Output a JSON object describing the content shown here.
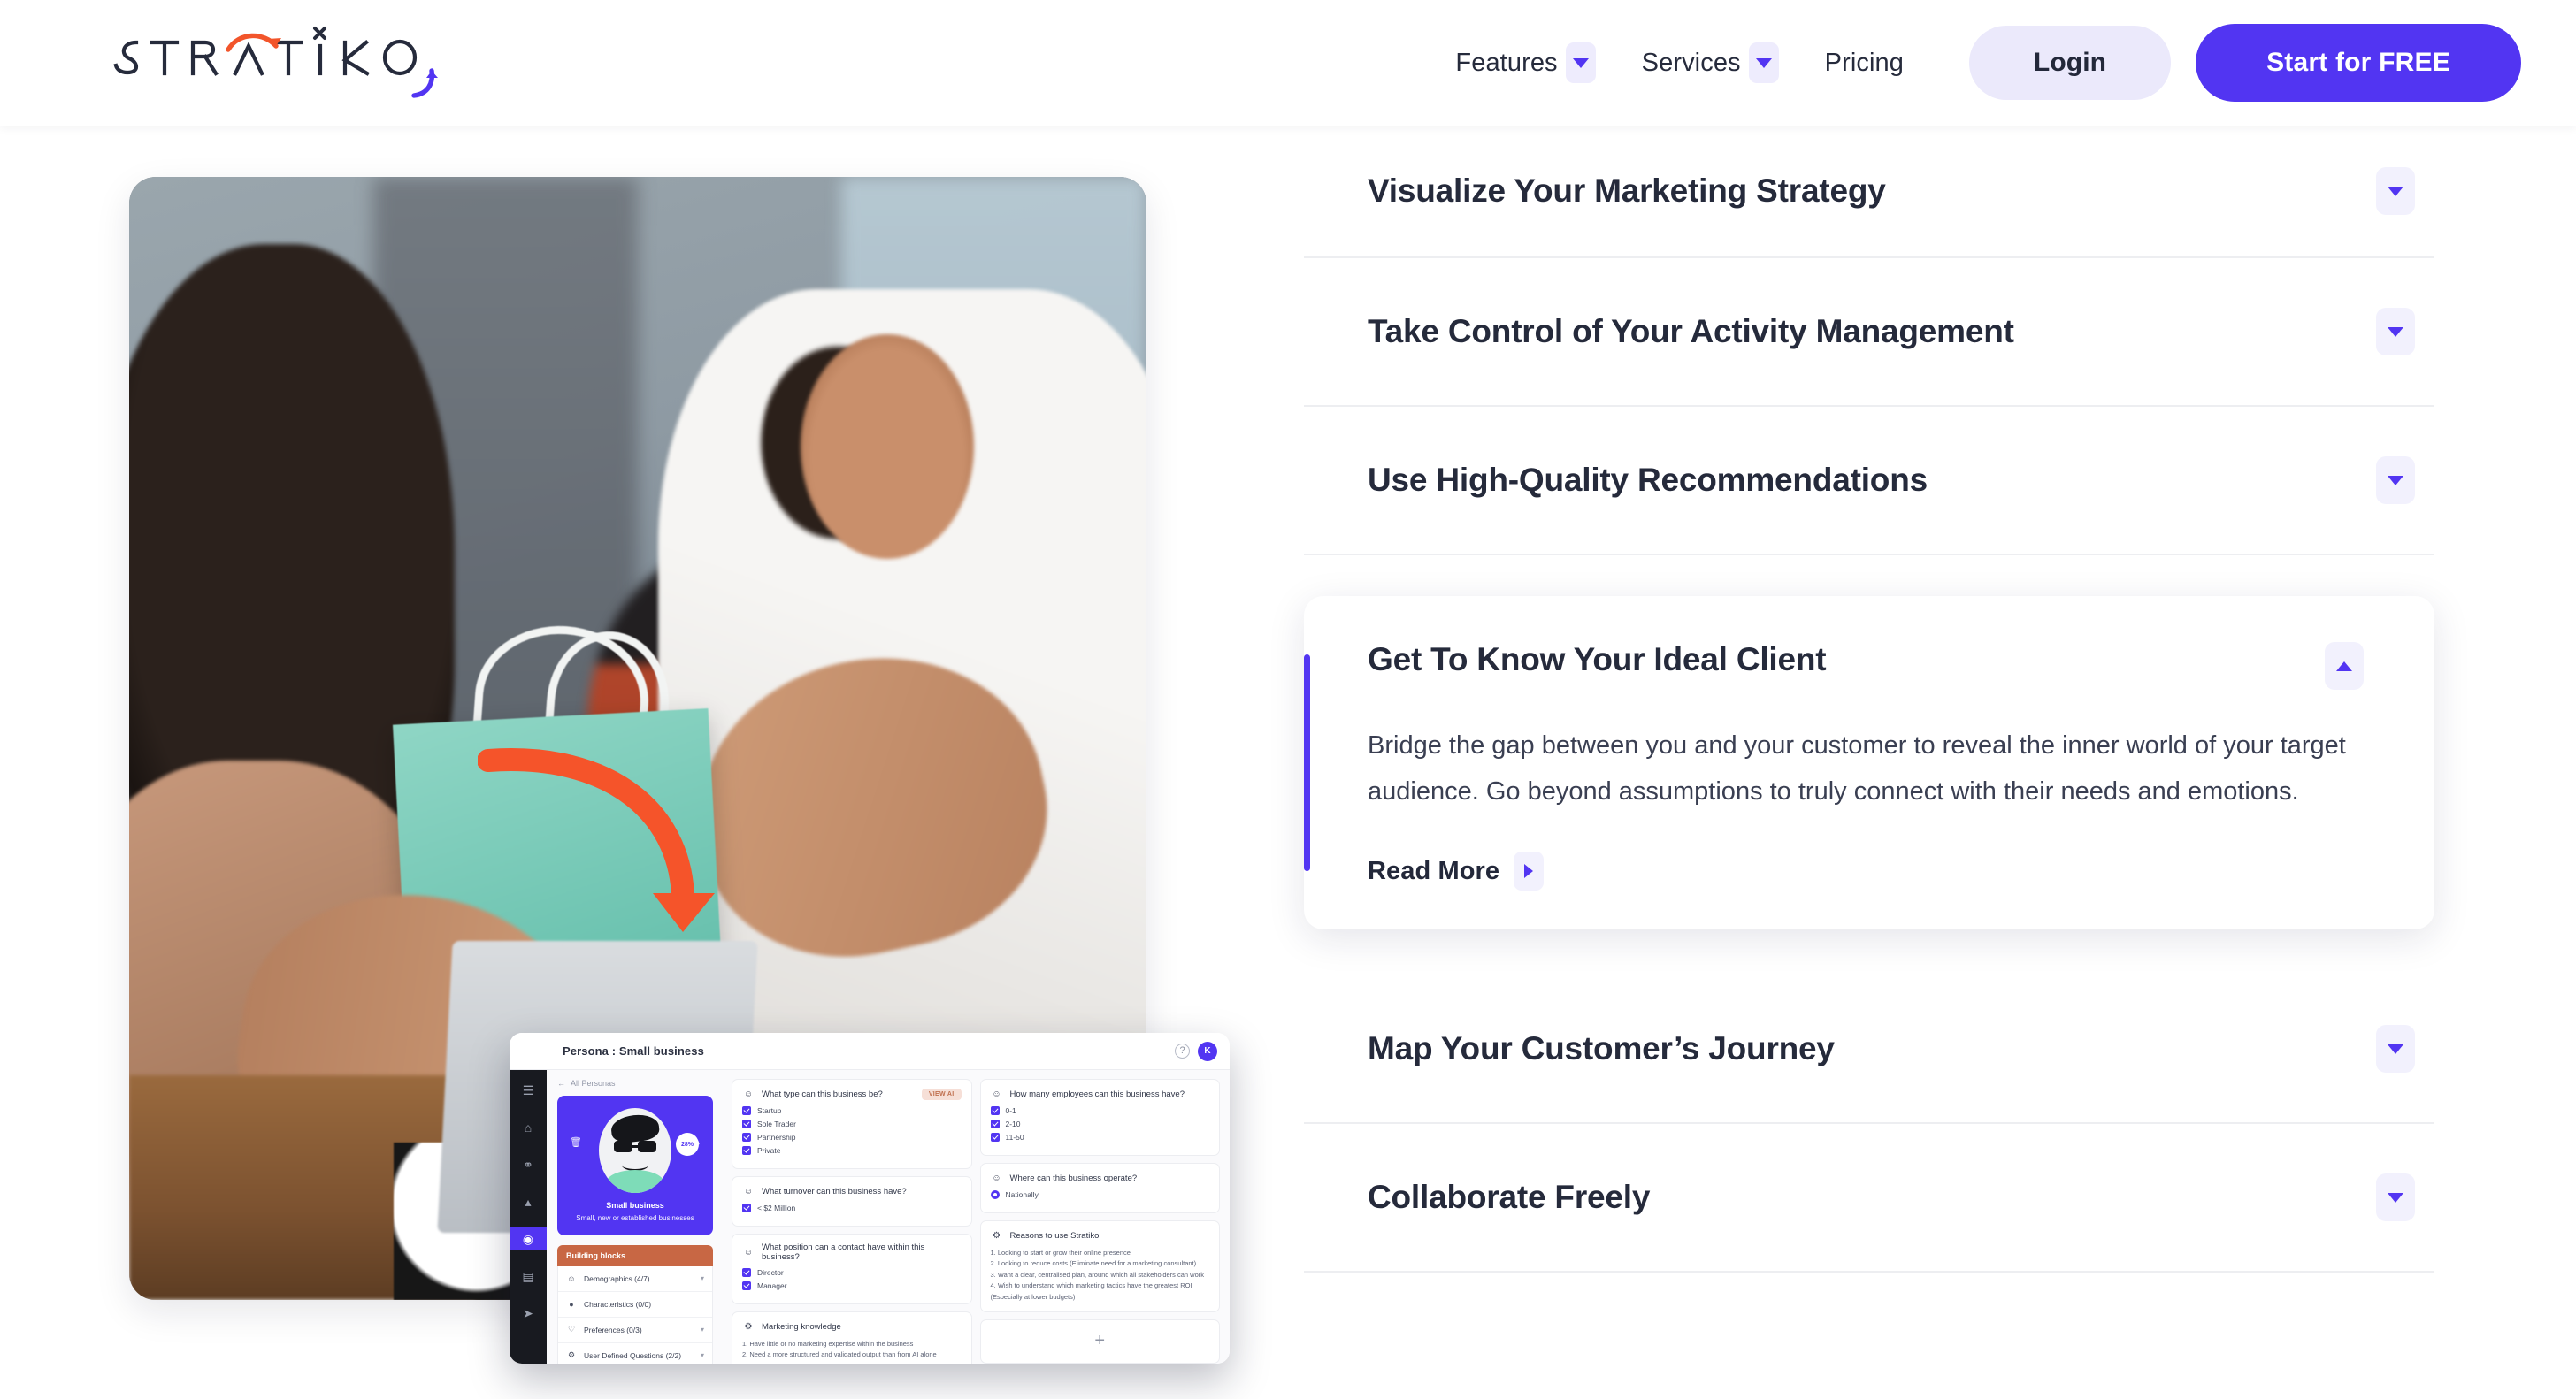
{
  "brand": {
    "name": "STRATIKO",
    "letters": [
      "S",
      "T",
      "R",
      "A",
      "T",
      "I",
      "K",
      "O"
    ],
    "accent_purple": "#5235F2",
    "accent_orange": "#F2552B",
    "logo_marks": [
      "orange-arc-arrow",
      "x-mark-over-i",
      "purple-curved-arrow"
    ]
  },
  "header": {
    "nav": [
      {
        "label": "Features",
        "has_dropdown": true
      },
      {
        "label": "Services",
        "has_dropdown": true
      },
      {
        "label": "Pricing",
        "has_dropdown": false
      }
    ],
    "login_label": "Login",
    "cta_label": "Start for FREE"
  },
  "accordion": {
    "items_top": [
      {
        "title": "Visualize Your Marketing Strategy",
        "expanded": false,
        "icon": "chevron-down-icon"
      },
      {
        "title": "Take Control of Your Activity Management",
        "expanded": false,
        "icon": "chevron-down-icon"
      },
      {
        "title": "Use High-Quality Recommendations",
        "expanded": false,
        "icon": "chevron-down-icon"
      }
    ],
    "expanded_item": {
      "title": "Get To Know Your Ideal Client",
      "body": "Bridge the gap between you and your customer to reveal the inner world of your target audience. Go beyond assumptions to truly connect with their needs and emotions.",
      "read_more_label": "Read More",
      "icon": "chevron-up-icon",
      "read_more_icon": "chevron-right-icon",
      "accent_color": "#5235F2"
    },
    "items_bottom": [
      {
        "title": "Map Your Customer’s Journey",
        "expanded": false,
        "icon": "chevron-down-icon"
      },
      {
        "title": "Collaborate Freely",
        "expanded": false,
        "icon": "chevron-down-icon"
      }
    ]
  },
  "media": {
    "photo_alt": "Shop assistant handing a teal shopping bag to a customer in a boutique",
    "overlay_arrow": "orange-curved-arrow"
  },
  "app_screenshot": {
    "titlebar": {
      "title": "Persona : Small business",
      "help_icon": "help-circle-icon",
      "avatar_initials": "K"
    },
    "rail_icons": [
      "menu-icon",
      "home-icon",
      "lightbulb-icon",
      "chart-icon",
      "persona-icon",
      "briefcase-icon",
      "rocket-icon"
    ],
    "back_label": "All Personas",
    "persona": {
      "name": "Small business",
      "description": "Small, new or established businesses",
      "percent": "28%",
      "delete_icon": "trash-icon",
      "edit_icon": "edit-icon"
    },
    "building_blocks": {
      "heading": "Building blocks",
      "rows": [
        {
          "label": "Demographics (4/7)",
          "icon": "people-icon",
          "chevron": true
        },
        {
          "label": "Characteristics (0/0)",
          "icon": "face-icon",
          "chevron": false
        },
        {
          "label": "Preferences (0/3)",
          "icon": "heart-icon",
          "chevron": true
        },
        {
          "label": "User Defined Questions (2/2)",
          "icon": "gear-icon",
          "chevron": true
        }
      ]
    },
    "left_column": [
      {
        "question": "What type can this business be?",
        "icon": "people-icon",
        "badge": "VIEW AI",
        "options": [
          "Startup",
          "Sole Trader",
          "Partnership",
          "Private"
        ],
        "control": "checkbox"
      },
      {
        "question": "What turnover can this business have?",
        "icon": "people-icon",
        "options": [
          "< $2 Million"
        ],
        "control": "checkbox"
      },
      {
        "question": "What position can a contact have within this business?",
        "icon": "people-icon",
        "options": [
          "Director",
          "Manager"
        ],
        "control": "checkbox"
      },
      {
        "question": "Marketing knowledge",
        "icon": "gear-icon",
        "lines": [
          "1. Have little or no marketing expertise within the business",
          "2. Need a more structured and validated output than from AI alone"
        ]
      }
    ],
    "right_column": [
      {
        "question": "How many employees can this business have?",
        "icon": "people-icon",
        "options": [
          "0-1",
          "2-10",
          "11-50"
        ],
        "control": "checkbox"
      },
      {
        "question": "Where can this business operate?",
        "icon": "people-icon",
        "options": [
          "Nationally"
        ],
        "control": "radio"
      },
      {
        "question": "Reasons to use Stratiko",
        "icon": "gear-icon",
        "lines": [
          "1. Looking to start or grow their online presence",
          "2. Looking to reduce costs (Eliminate need for a marketing consultant)",
          "3. Want a clear, centralised plan, around which all stakeholders can work",
          "4. Wish to understand which marketing tactics have the greatest ROI (Especially at lower budgets)"
        ]
      }
    ],
    "add_card_icon": "plus-icon"
  }
}
